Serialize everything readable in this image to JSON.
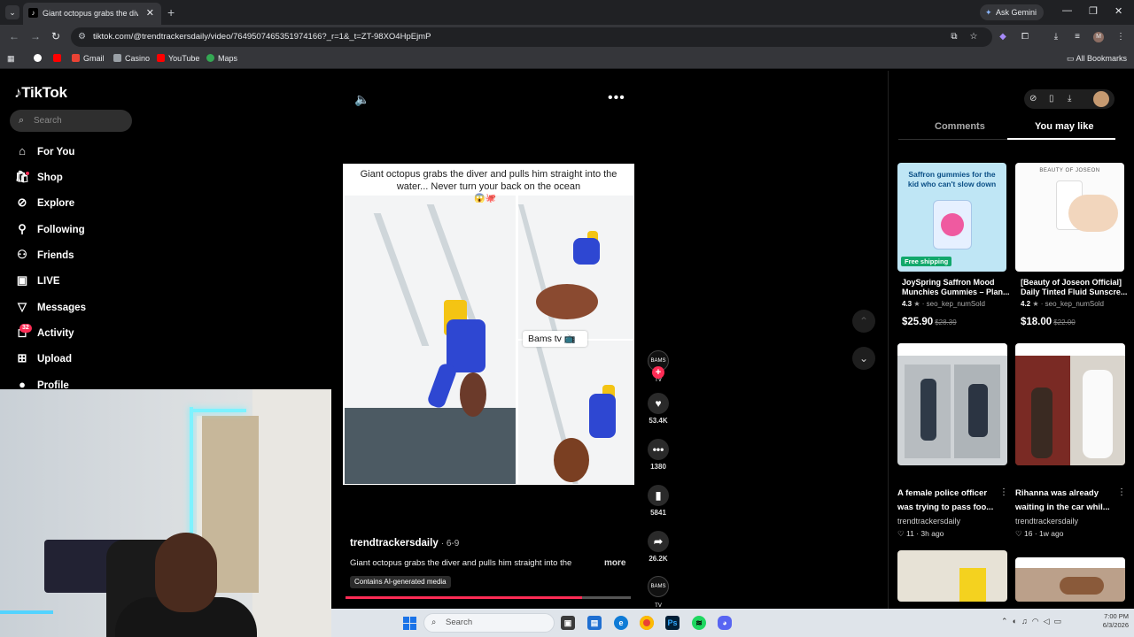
{
  "browser": {
    "tab_title": "Giant octopus grabs the diver a",
    "tab_close": "✕",
    "new_tab": "+",
    "gemini_label": "Ask Gemini",
    "url": "tiktok.com/@trendtrackersdaily/video/7649507465351974166?_r=1&_t=ZT-98XO4HpEjmP",
    "bookmarks": [
      {
        "label": "",
        "color": "#ffffff"
      },
      {
        "label": "",
        "color": "#ff0000"
      },
      {
        "label": "Gmail",
        "color": "#ea4335"
      },
      {
        "label": "Casino",
        "color": "#9aa0a6"
      },
      {
        "label": "YouTube",
        "color": "#ff0000"
      },
      {
        "label": "Maps",
        "color": "#34a853"
      }
    ],
    "all_bookmarks": "All Bookmarks"
  },
  "tiktok": {
    "logo": "TikTok",
    "search_placeholder": "Search",
    "nav": [
      {
        "label": "For You",
        "icon": "home-icon"
      },
      {
        "label": "Shop",
        "icon": "shop-icon"
      },
      {
        "label": "Explore",
        "icon": "compass-icon"
      },
      {
        "label": "Following",
        "icon": "following-icon"
      },
      {
        "label": "Friends",
        "icon": "friends-icon"
      },
      {
        "label": "LIVE",
        "icon": "live-icon"
      },
      {
        "label": "Messages",
        "icon": "messages-icon"
      },
      {
        "label": "Activity",
        "icon": "activity-icon"
      },
      {
        "label": "Upload",
        "icon": "upload-icon"
      },
      {
        "label": "Profile",
        "icon": "profile-icon"
      }
    ],
    "activity_badge": "32"
  },
  "video": {
    "caption_overlay": "Giant octopus grabs the diver and pulls him straight into the water... Never turn your back on the ocean",
    "emoji_overlay": "😱🐙",
    "watermark_label": "Bams tv 📺",
    "author": "trendtrackersdaily",
    "date": "· 6-9",
    "description": "Giant octopus grabs the diver and pulls him straight into the",
    "more": "more",
    "ai_badge": "Contains AI-generated media",
    "progress": 0.83,
    "likes": "53.4K",
    "comments": "1380",
    "saves": "5841",
    "shares": "26.2K",
    "account_label": "BAMS TV"
  },
  "right_panel": {
    "tabs": [
      "Comments",
      "You may like"
    ],
    "products": [
      {
        "banner": "Saffron gummies for the kid who can't slow down",
        "shipping_badge": "Free shipping",
        "title": "JoySpring Saffron Mood Munchies Gummies – Plan...",
        "rating": "4.3",
        "sold": "· seo_kep_numSold",
        "price": "$25.90",
        "old_price": "$28.39"
      },
      {
        "banner": "BEAUTY OF JOSEON",
        "title": "[Beauty of Joseon Official] Daily Tinted Fluid Sunscre...",
        "rating": "4.2",
        "sold": "· seo_kep_numSold",
        "price": "$18.00",
        "old_price": "$22.00"
      }
    ],
    "videos": [
      {
        "title": "A female police officer was trying to pass foo...",
        "author": "trendtrackersdaily",
        "likes": "11",
        "age": "· 3h ago"
      },
      {
        "title": "Rihanna was already waiting in the car whil...",
        "author": "trendtrackersdaily",
        "likes": "16",
        "age": "· 1w ago"
      }
    ]
  },
  "taskbar": {
    "search_placeholder": "Search",
    "time": "7:00 PM",
    "date": "6/3/2026"
  }
}
